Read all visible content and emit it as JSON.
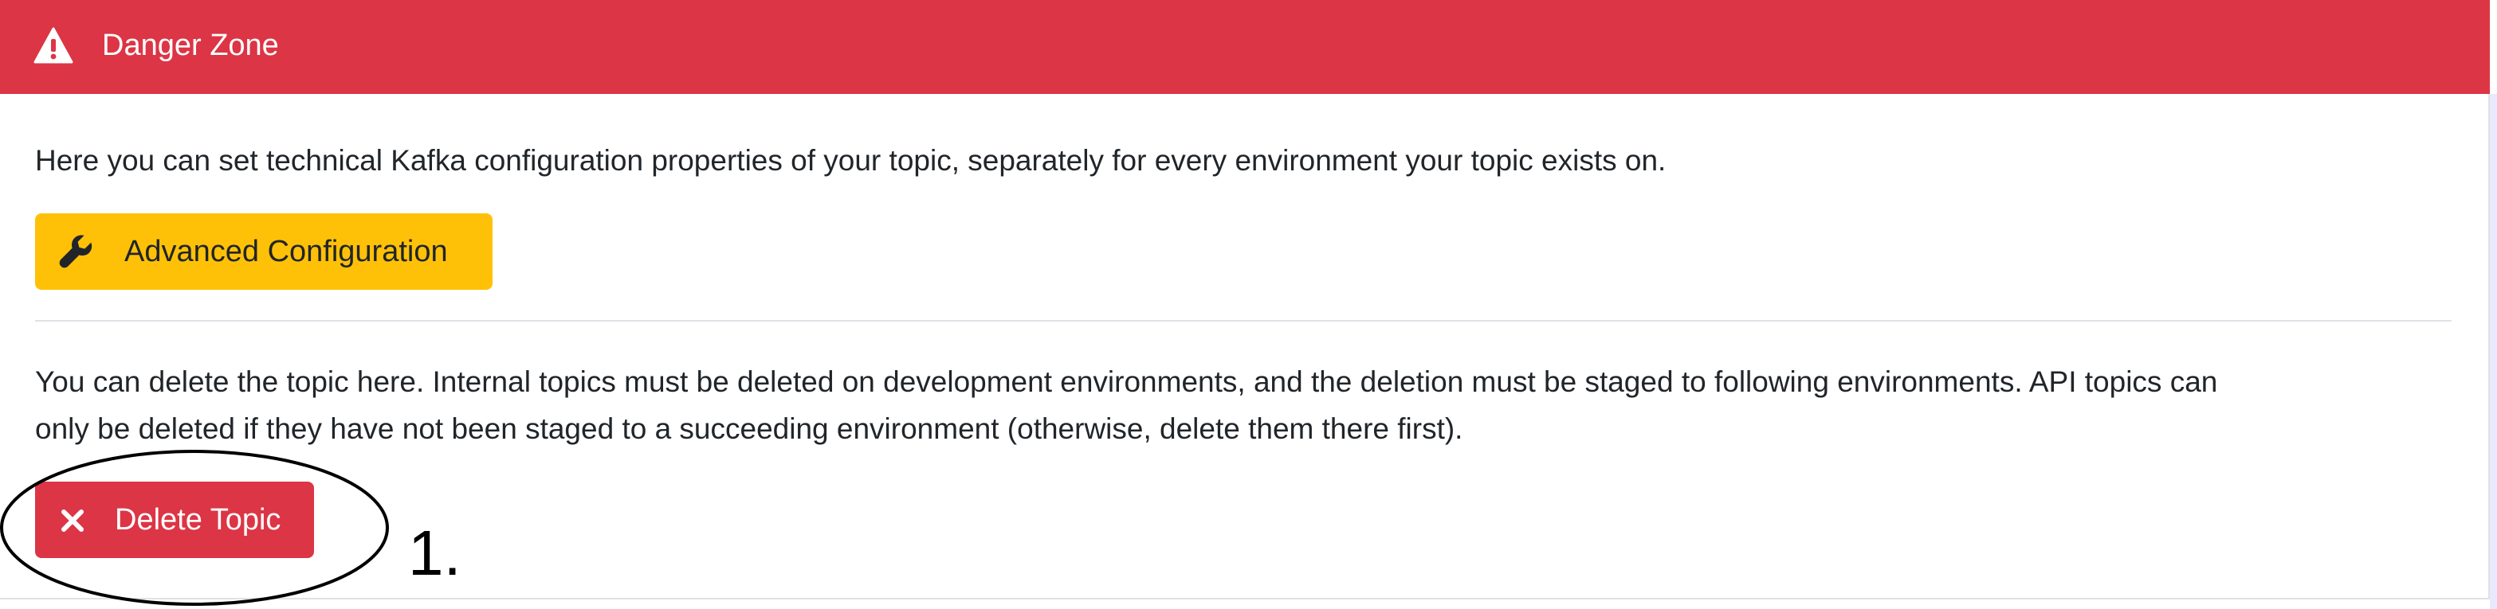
{
  "header": {
    "title": "Danger Zone",
    "icon": "warning-icon",
    "color": "#dc3545"
  },
  "config": {
    "description": "Here you can set technical Kafka configuration properties of your topic, separately for every environment your topic exists on.",
    "button_label": "Advanced Configuration",
    "button_icon": "wrench-icon",
    "button_color": "#ffc107"
  },
  "delete": {
    "description_line1": "You can delete the topic here. Internal topics must be deleted on development environments, and the deletion must be staged to following environments. API topics can",
    "description_line2": "only be deleted if they have not been staged to a succeeding environment (otherwise, delete them there first).",
    "button_label": "Delete Topic",
    "button_icon": "close-icon",
    "button_color": "#dc3545"
  },
  "annotation": {
    "number": "1."
  }
}
